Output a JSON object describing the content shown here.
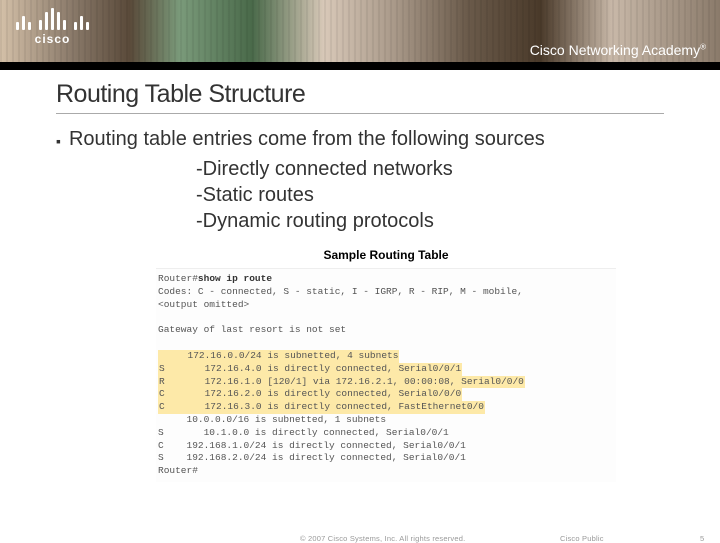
{
  "brand": {
    "logo_text": "cisco",
    "academy": "Cisco Networking Academy"
  },
  "slide": {
    "title": "Routing Table Structure",
    "bullet": "Routing table entries come from the following sources",
    "sub_items": [
      "-Directly connected networks",
      "-Static routes",
      "-Dynamic routing protocols"
    ]
  },
  "figure": {
    "title": "Sample Routing Table",
    "lines_top": [
      "Router#show ip route",
      "Codes: C - connected, S - static, I - IGRP, R - RIP, M - mobile,",
      "<output omitted>",
      "",
      "Gateway of last resort is not set",
      ""
    ],
    "lines_hl": [
      "     172.16.0.0/24 is subnetted, 4 subnets",
      "S       172.16.4.0 is directly connected, Serial0/0/1",
      "R       172.16.1.0 [120/1] via 172.16.2.1, 00:00:08, Serial0/0/0",
      "C       172.16.2.0 is directly connected, Serial0/0/0",
      "C       172.16.3.0 is directly connected, FastEthernet0/0"
    ],
    "lines_bottom": [
      "     10.0.0.0/16 is subnetted, 1 subnets",
      "S       10.1.0.0 is directly connected, Serial0/0/1",
      "C    192.168.1.0/24 is directly connected, Serial0/0/1",
      "S    192.168.2.0/24 is directly connected, Serial0/0/1",
      "Router#"
    ]
  },
  "footer": {
    "copyright": "© 2007 Cisco Systems, Inc. All rights reserved.",
    "label": "Cisco Public",
    "page": "5"
  }
}
